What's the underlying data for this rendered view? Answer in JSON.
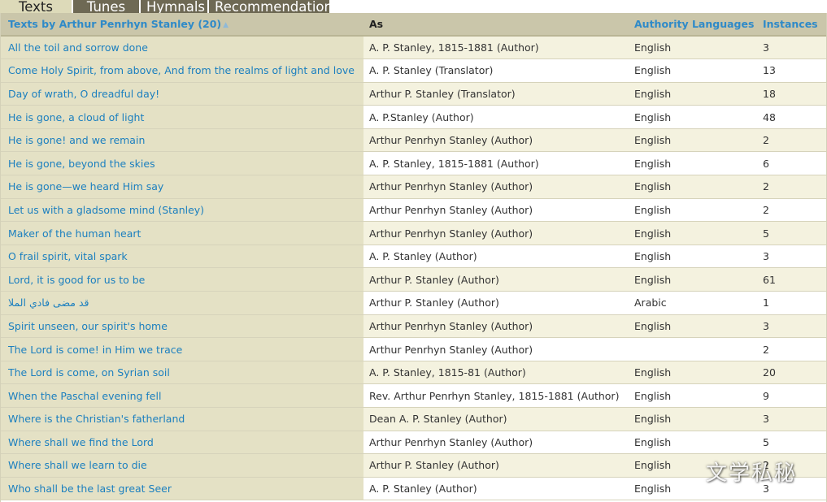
{
  "tabs": [
    {
      "label": "Texts",
      "active": true
    },
    {
      "label": "Tunes",
      "active": false
    },
    {
      "label": "Hymnals",
      "active": false
    },
    {
      "label": "Recommendations",
      "active": false
    }
  ],
  "table": {
    "headers": {
      "title": "Texts by Arthur Penrhyn Stanley (20)",
      "sort_indicator": "▲",
      "as": "As",
      "languages": "Authority Languages",
      "instances": "Instances"
    },
    "rows": [
      {
        "title": "All the toil and sorrow done",
        "as": "A. P. Stanley, 1815-1881 (Author)",
        "language": "English",
        "instances": "3"
      },
      {
        "title": "Come Holy Spirit, from above, And from the realms of light and love",
        "as": "A. P. Stanley (Translator)",
        "language": "English",
        "instances": "13"
      },
      {
        "title": "Day of wrath, O dreadful day!",
        "as": "Arthur P. Stanley (Translator)",
        "language": "English",
        "instances": "18"
      },
      {
        "title": "He is gone, a cloud of light",
        "as": "A. P.Stanley (Author)",
        "language": "English",
        "instances": "48"
      },
      {
        "title": "He is gone! and we remain",
        "as": "Arthur Penrhyn Stanley (Author)",
        "language": "English",
        "instances": "2"
      },
      {
        "title": "He is gone, beyond the skies",
        "as": "A. P. Stanley, 1815-1881 (Author)",
        "language": "English",
        "instances": "6"
      },
      {
        "title": "He is gone—we heard Him say",
        "as": "Arthur Penrhyn Stanley (Author)",
        "language": "English",
        "instances": "2"
      },
      {
        "title": "Let us with a gladsome mind (Stanley)",
        "as": "Arthur Penrhyn Stanley (Author)",
        "language": "English",
        "instances": "2"
      },
      {
        "title": "Maker of the human heart",
        "as": "Arthur Penrhyn Stanley (Author)",
        "language": "English",
        "instances": "5"
      },
      {
        "title": "O frail spirit, vital spark",
        "as": "A. P. Stanley (Author)",
        "language": "English",
        "instances": "3"
      },
      {
        "title": "Lord, it is good for us to be",
        "as": "Arthur P. Stanley (Author)",
        "language": "English",
        "instances": "61"
      },
      {
        "title": "قد مضى فادي الملا",
        "as": "Arthur P. Stanley (Author)",
        "language": "Arabic",
        "instances": "1"
      },
      {
        "title": "Spirit unseen, our spirit's home",
        "as": "Arthur Penrhyn Stanley (Author)",
        "language": "English",
        "instances": "3"
      },
      {
        "title": "The Lord is come! in Him we trace",
        "as": "Arthur Penrhyn Stanley (Author)",
        "language": "",
        "instances": "2"
      },
      {
        "title": "The Lord is come, on Syrian soil",
        "as": "A. P. Stanley, 1815-81 (Author)",
        "language": "English",
        "instances": "20"
      },
      {
        "title": "When the Paschal evening fell",
        "as": "Rev. Arthur Penrhyn Stanley, 1815-1881 (Author)",
        "language": "English",
        "instances": "9"
      },
      {
        "title": "Where is the Christian's fatherland",
        "as": "Dean A. P. Stanley (Author)",
        "language": "English",
        "instances": "3"
      },
      {
        "title": "Where shall we find the Lord",
        "as": "Arthur Penrhyn Stanley (Author)",
        "language": "English",
        "instances": "5"
      },
      {
        "title": "Where shall we learn to die",
        "as": "Arthur P. Stanley (Author)",
        "language": "English",
        "instances": "2"
      },
      {
        "title": "Who shall be the last great Seer",
        "as": "A. P. Stanley (Author)",
        "language": "English",
        "instances": "3"
      }
    ]
  },
  "watermark": "文学私秘"
}
